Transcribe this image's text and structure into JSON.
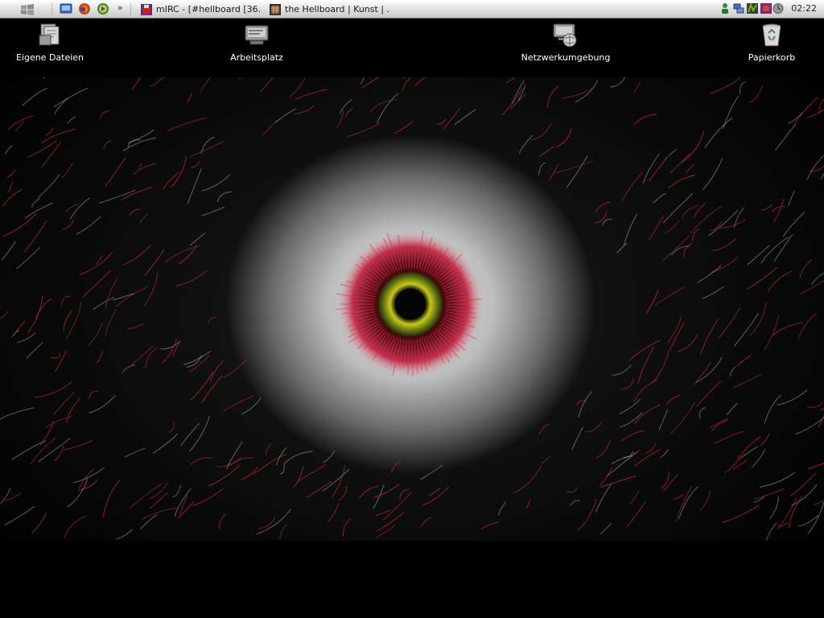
{
  "taskbar": {
    "tasks": [
      {
        "label": "mIRC - [#hellboard [36..."
      },
      {
        "label": "the Hellboard | Kunst | ..."
      }
    ],
    "overflow_chevron": "»",
    "clock": "02:22"
  },
  "desktop": {
    "icons": [
      {
        "label": "Eigene Dateien"
      },
      {
        "label": "Arbeitsplatz"
      },
      {
        "label": "Netzwerkumgebung"
      },
      {
        "label": "Papierkorb"
      }
    ]
  },
  "colors": {
    "taskbar_top": "#ffffff",
    "taskbar_bottom": "#c9c9c9",
    "desktop_bg": "#000000",
    "eye_outer_red": "#c0304a",
    "eye_iris_yellow": "#c8c81a"
  }
}
